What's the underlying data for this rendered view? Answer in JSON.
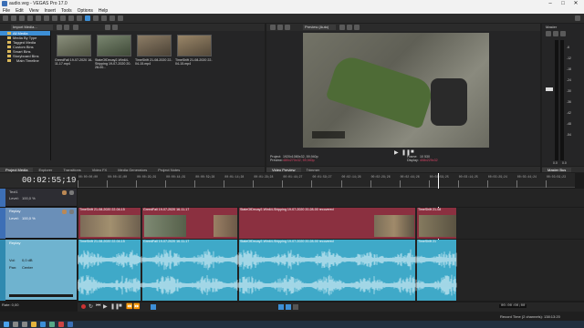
{
  "window": {
    "title": "audio.veg - VEGAS Pro 17.0"
  },
  "menu": [
    "File",
    "Edit",
    "View",
    "Insert",
    "Tools",
    "Options",
    "Help"
  ],
  "explorer": {
    "dropdown": "Import Media...",
    "tree": [
      "All Media",
      "Media By Type",
      "Tagged Media",
      "Custom Bins",
      "Smart Bins",
      "Storyboard Bins",
      "Main Timeline"
    ],
    "items": [
      {
        "label": "GreedFall 19-07-2020 16-11-17.mp4",
        "color": "#6a6f58"
      },
      {
        "label": "StateOfDecay2-Win64-Shipping 19-07-2020 20-28-00...",
        "color": "#5f6f57"
      },
      {
        "label": "TimeShift 21-08-2020 22-04-15.mp4",
        "color": "#6d6457"
      },
      {
        "label": "TimeShift 21-08-2020 22-04-15.mp4",
        "color": "#7a6c5a"
      }
    ]
  },
  "bottom_tabs_left": [
    "Project Media",
    "Explorer",
    "Transitions",
    "Video FX",
    "Media Generators",
    "Project Notes"
  ],
  "preview": {
    "dropdown": "Preview (Auto)",
    "project_label": "Project:",
    "project_val": "1920x1080x32, 59,940p",
    "preview_label": "Preview:",
    "preview_val": "480x270x32, 59,940p",
    "frame_label": "Frame:",
    "frame_val": "10 530",
    "display_label": "Display:",
    "display_val": "408x229x32"
  },
  "preview_tabs": [
    "Video Preview",
    "Trimmer"
  ],
  "master": {
    "label": "Master",
    "bus_tab": "Master Bus",
    "scale": [
      "-6",
      "-12",
      "-18",
      "-24",
      "-30",
      "-36",
      "-42",
      "-48",
      "-54"
    ],
    "level_left": "0.0",
    "level_right": "0.0"
  },
  "timecode": "00:02:55;19",
  "ruler": [
    "00:00:00;00",
    "00:00:15;00",
    "00:00:29;29",
    "00:00:44;29",
    "00:00:59;28",
    "00:01:14;28",
    "00:01:29;28",
    "00:01:44;27",
    "00:01:59;27",
    "00:02:14;26",
    "00:02:29;26",
    "00:02:44;26",
    "00:02:59;25",
    "00:03:14;25",
    "00:03:29;24",
    "00:03:44;24",
    "00:03:59;23"
  ],
  "tracks": [
    {
      "name": "Text1",
      "level_label": "Level:",
      "level": "100,0 %",
      "type": "text"
    },
    {
      "name": "Replay",
      "level_label": "Level:",
      "level": "100,0 %",
      "type": "video"
    },
    {
      "name": "Replay",
      "vol_label": "Vol:",
      "vol": "0,0 dB",
      "pan_label": "Pan:",
      "pan": "Center",
      "type": "audio"
    }
  ],
  "video_clips": [
    {
      "label": "TimeShift 21-08-2020 22-04-15",
      "color": "#8b3040"
    },
    {
      "label": "GreedFall 19-07-2020 16-11-17",
      "color": "#8b3040"
    },
    {
      "label": "StateOfDecay2-Win64-Shipping 19-07-2020 20-28-00 recovered",
      "color": "#8b3040"
    },
    {
      "label": "TimeShift 21-08",
      "color": "#8b3040"
    }
  ],
  "audio_clips": [
    {
      "label": "TimeShift 21-08-2020 22-04-15"
    },
    {
      "label": "GreedFall 19-07-2020 16-11-17"
    },
    {
      "label": "StateOfDecay2-Win64-Shipping 19-07-2020 20-28-00 recovered"
    },
    {
      "label": "TimeShift 21"
    }
  ],
  "rate": "Rate: 0,00",
  "status": {
    "timecode": "00:00:00;00",
    "record": "Record Time (2 channels): 138:13:20"
  },
  "colors": {
    "accent": "#3d8fd6",
    "video_track": "#8b3040",
    "audio_track": "#3fa9c8"
  }
}
